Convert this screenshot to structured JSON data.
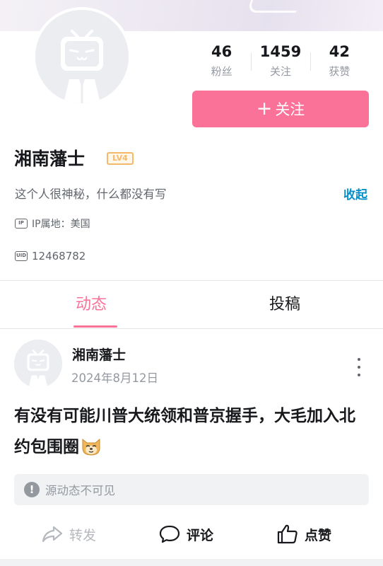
{
  "profile": {
    "name": "湘南藩士",
    "level": "LV4",
    "bio": "这个人很神秘，什么都没有写",
    "collapse_label": "收起",
    "ip_badge": "IP",
    "ip_location": "IP属地：美国",
    "uid_badge": "UID",
    "uid": "12468782"
  },
  "stats": [
    {
      "value": "46",
      "label": "粉丝"
    },
    {
      "value": "1459",
      "label": "关注"
    },
    {
      "value": "42",
      "label": "获赞"
    }
  ],
  "follow_button": {
    "icon": "plus-icon",
    "label": "关注"
  },
  "tabs": [
    {
      "label": "动态",
      "active": true
    },
    {
      "label": "投稿",
      "active": false
    }
  ],
  "post": {
    "author": "湘南藩士",
    "date": "2024年8月12日",
    "text": "有没有可能川普大统领和普京握手，大毛加入北约包围圈",
    "emoji": "doge-emoji",
    "source_notice": "源动态不可见"
  },
  "actions": {
    "share": "转发",
    "comment": "评论",
    "like": "点赞"
  },
  "colors": {
    "accent": "#fb7299",
    "link": "#0a8ec9",
    "level": "#f6b96a",
    "muted": "#9499a0"
  }
}
